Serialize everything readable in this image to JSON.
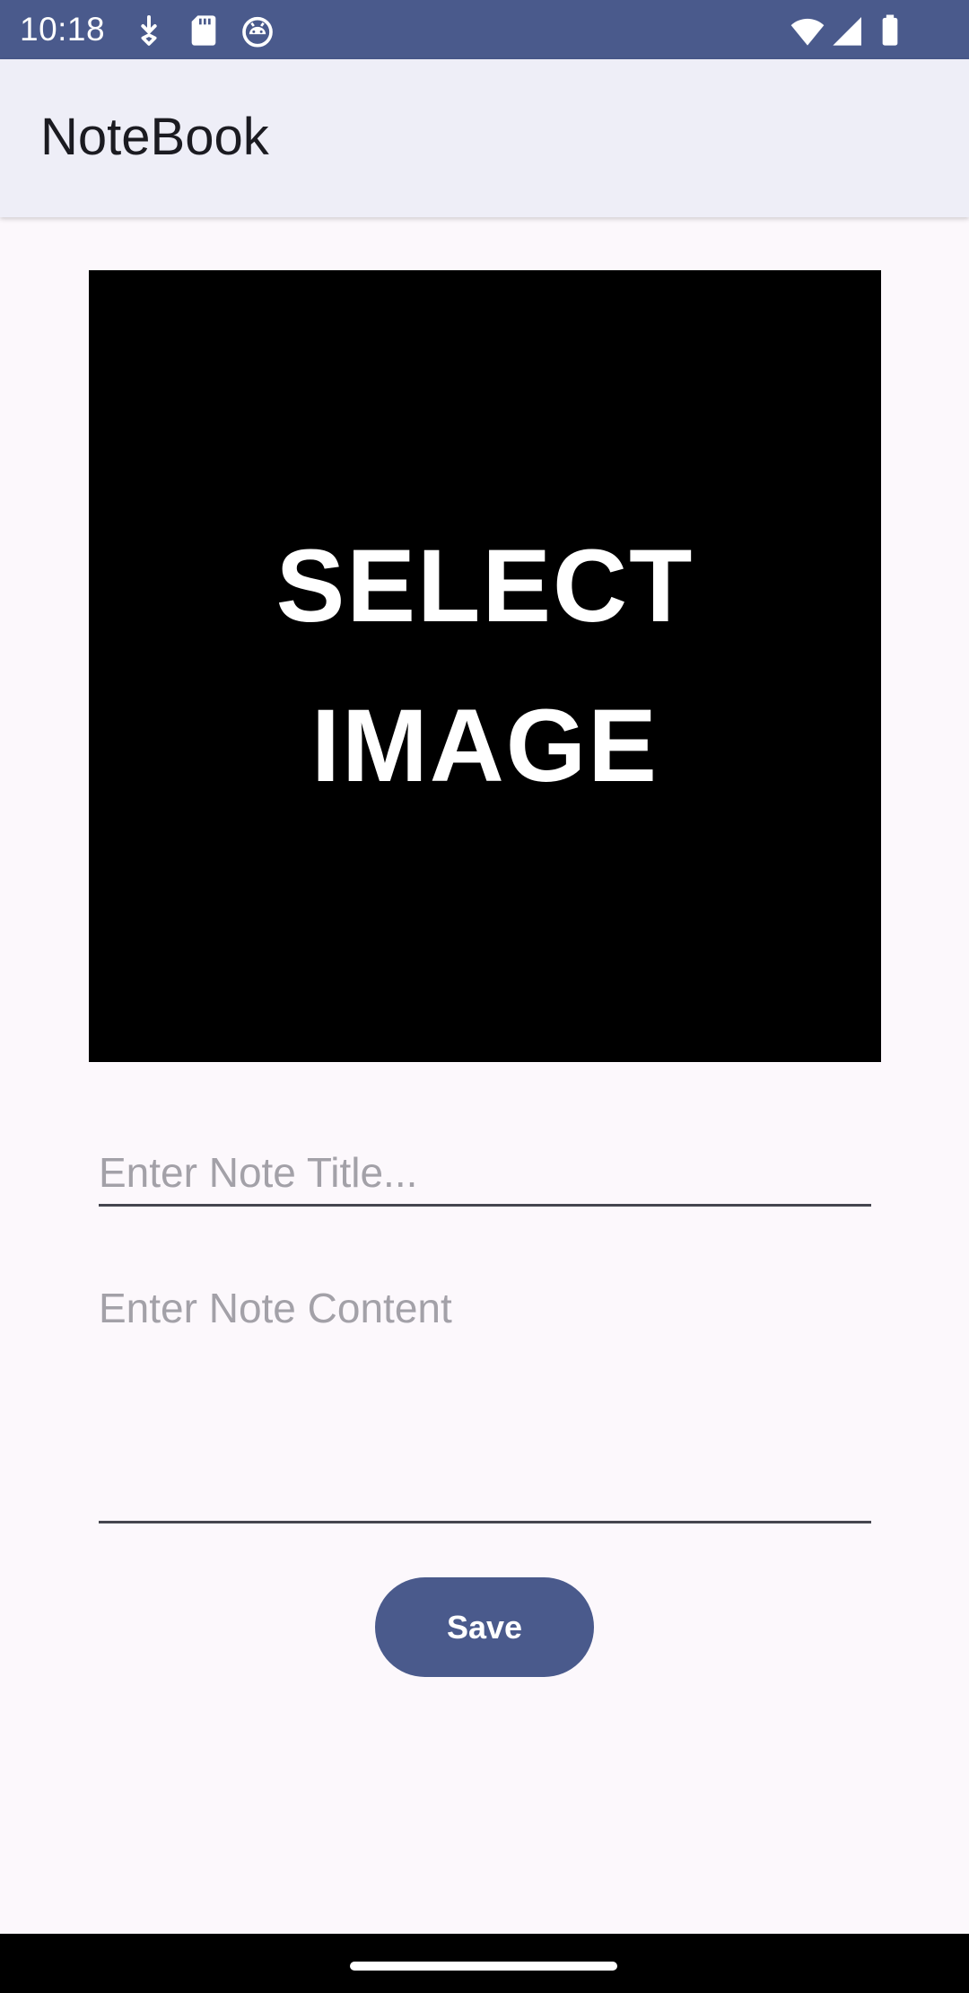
{
  "status_bar": {
    "time": "10:18",
    "left_icons": [
      "download-icon",
      "sd-card-icon",
      "android-robot-icon"
    ],
    "right_icons": [
      "wifi-icon",
      "cell-signal-icon",
      "battery-icon"
    ],
    "background": "#4a5a8c"
  },
  "app_bar": {
    "title": "NoteBook",
    "background": "#eeeef7"
  },
  "image_picker": {
    "line1": "SELECT",
    "line2": "IMAGE"
  },
  "form": {
    "title_placeholder": "Enter Note Title...",
    "title_value": "",
    "content_placeholder": "Enter Note Content",
    "content_value": "",
    "save_label": "Save"
  },
  "colors": {
    "accent": "#4a5a8c",
    "background": "#fcf8fc",
    "placeholder": "#a3a1a8"
  }
}
